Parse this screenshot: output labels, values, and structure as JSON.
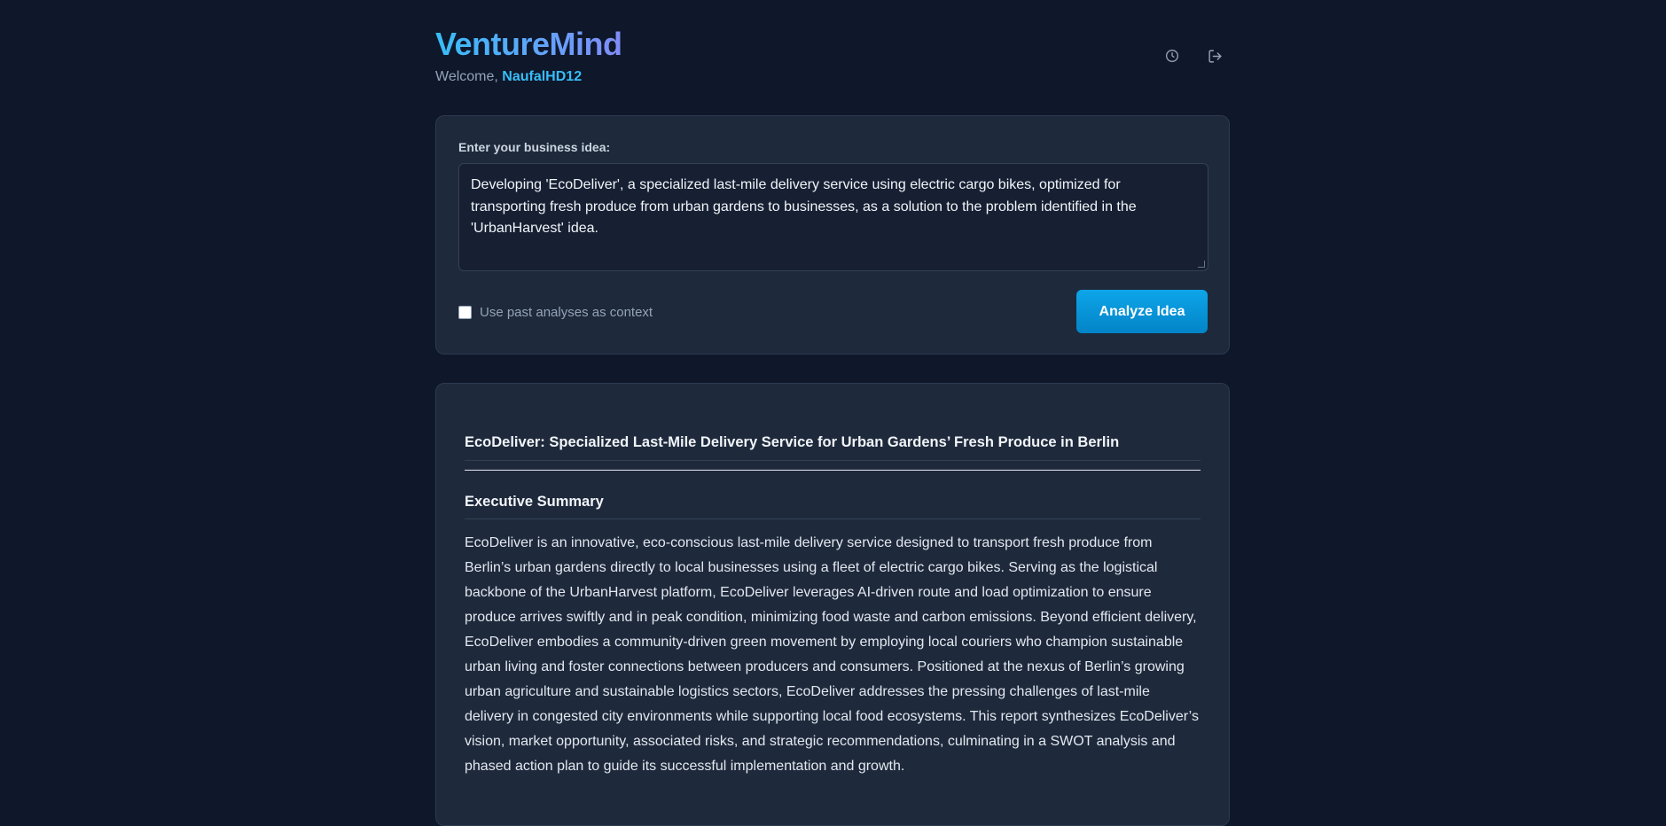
{
  "header": {
    "brand": "VentureMind",
    "welcome_prefix": "Welcome, ",
    "username": "NaufalHD12",
    "history_icon": "history-clock-icon",
    "logout_icon": "logout-icon"
  },
  "input": {
    "label": "Enter your business idea:",
    "idea_text": "Developing 'EcoDeliver', a specialized last-mile delivery service using electric cargo bikes, optimized for transporting fresh produce from urban gardens to businesses, as a solution to the problem identified in the 'UrbanHarvest' idea.",
    "context_checkbox_label": "Use past analyses as context",
    "context_checked": false,
    "analyze_button": "Analyze Idea"
  },
  "report": {
    "title": "EcoDeliver: Specialized Last-Mile Delivery Service for Urban Gardens’ Fresh Produce in Berlin",
    "section_heading": "Executive Summary",
    "summary": "EcoDeliver is an innovative, eco-conscious last-mile delivery service designed to transport fresh produce from Berlin’s urban gardens directly to local businesses using a fleet of electric cargo bikes. Serving as the logistical backbone of the UrbanHarvest platform, EcoDeliver leverages AI-driven route and load optimization to ensure produce arrives swiftly and in peak condition, minimizing food waste and carbon emissions. Beyond efficient delivery, EcoDeliver embodies a community-driven green movement by employing local couriers who champion sustainable urban living and foster connections between producers and consumers. Positioned at the nexus of Berlin’s growing urban agriculture and sustainable logistics sectors, EcoDeliver addresses the pressing challenges of last-mile delivery in congested city environments while supporting local food ecosystems. This report synthesizes EcoDeliver’s vision, market opportunity, associated risks, and strategic recommendations, culminating in a SWOT analysis and phased action plan to guide its successful implementation and growth."
  },
  "colors": {
    "background": "#0f172a",
    "card": "#1e293b",
    "accent": "#38bdf8",
    "button": "#0ea5e9"
  }
}
